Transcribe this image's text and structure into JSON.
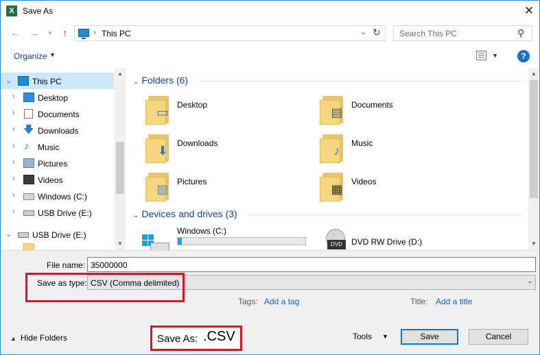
{
  "window": {
    "title": "Save As",
    "close_glyph": "✕"
  },
  "address": {
    "crumb": "This PC"
  },
  "search": {
    "placeholder": "Search This PC"
  },
  "toolbar": {
    "organize": "Organize"
  },
  "nav_pane": {
    "items": [
      {
        "label": "This PC",
        "icon": "pc-icon",
        "selected": true
      },
      {
        "label": "Desktop",
        "icon": "desktop-icon"
      },
      {
        "label": "Documents",
        "icon": "documents-icon"
      },
      {
        "label": "Downloads",
        "icon": "downloads-icon"
      },
      {
        "label": "Music",
        "icon": "music-icon"
      },
      {
        "label": "Pictures",
        "icon": "pictures-icon"
      },
      {
        "label": "Videos",
        "icon": "videos-icon"
      },
      {
        "label": "Windows (C:)",
        "icon": "drive-icon"
      },
      {
        "label": "USB Drive (E:)",
        "icon": "usb-drive-icon"
      },
      {
        "label": "USB Drive (E:)",
        "icon": "usb-drive-icon"
      }
    ]
  },
  "content": {
    "folders_header": "Folders (6)",
    "folders": [
      "Desktop",
      "Documents",
      "Downloads",
      "Music",
      "Pictures",
      "Videos"
    ],
    "drives_header": "Devices and drives (3)",
    "drives": [
      {
        "label": "Windows (C:)",
        "used_fraction": 0.03
      },
      {
        "label": "DVD RW Drive (D:)"
      }
    ]
  },
  "form": {
    "file_name_label": "File name:",
    "file_name_value": "35000000",
    "save_type_label": "Save as type:",
    "save_type_value": "CSV (Comma delimited)",
    "tags_label": "Tags:",
    "tags_link": "Add a tag",
    "title_label": "Title:",
    "title_link": "Add a title"
  },
  "footer": {
    "hide_folders": "Hide Folders",
    "tools": "Tools",
    "save": "Save",
    "cancel": "Cancel"
  },
  "annotation": {
    "prefix": "Save As: ",
    "ext": ".CSV"
  },
  "colors": {
    "highlight_red": "#d9131e",
    "selection_blue": "#cce8ff",
    "link_blue": "#1a5fb4"
  }
}
